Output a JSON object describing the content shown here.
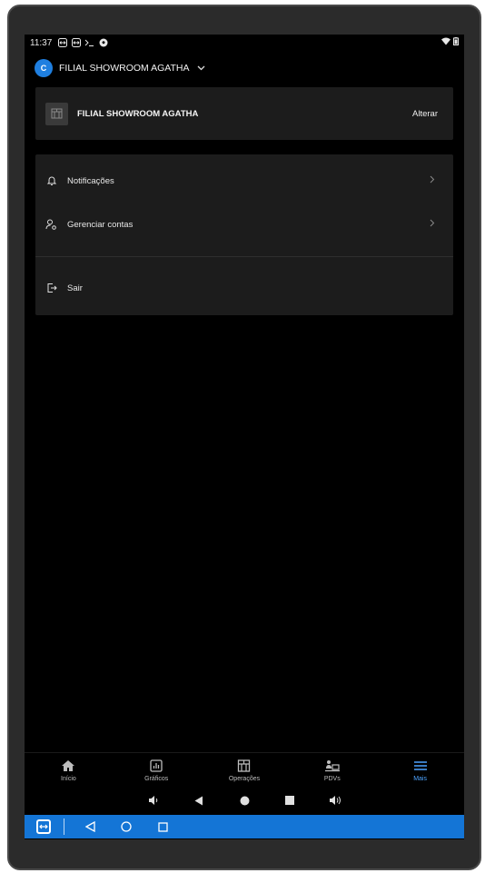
{
  "statusbar": {
    "time": "11:37",
    "icons": [
      "teamviewer-icon",
      "teamviewer-icon",
      "terminal-icon",
      "soccer-ball-icon"
    ],
    "right_icons": [
      "wifi-icon",
      "battery-icon"
    ]
  },
  "header": {
    "logo_text": "C",
    "store_selector_label": "FILIAL SHOWROOM AGATHA"
  },
  "branch_card": {
    "name": "FILIAL SHOWROOM AGATHA",
    "action_label": "Alterar"
  },
  "menu": {
    "items": [
      {
        "label": "Notificações",
        "icon": "bell-icon"
      },
      {
        "label": "Gerenciar contas",
        "icon": "user-settings-icon"
      },
      {
        "label": "Sair",
        "icon": "logout-icon"
      }
    ]
  },
  "bottom_nav": {
    "items": [
      {
        "label": "Início",
        "icon": "home-icon"
      },
      {
        "label": "Gráficos",
        "icon": "chart-icon"
      },
      {
        "label": "Operações",
        "icon": "store-icon"
      },
      {
        "label": "PDVs",
        "icon": "pos-terminal-icon"
      },
      {
        "label": "Mais",
        "icon": "menu-icon"
      }
    ],
    "active_index": 4
  },
  "colors": {
    "accent": "#4da3ff",
    "teamviewer_bar": "#1475d6",
    "card_bg": "#1c1c1c"
  }
}
